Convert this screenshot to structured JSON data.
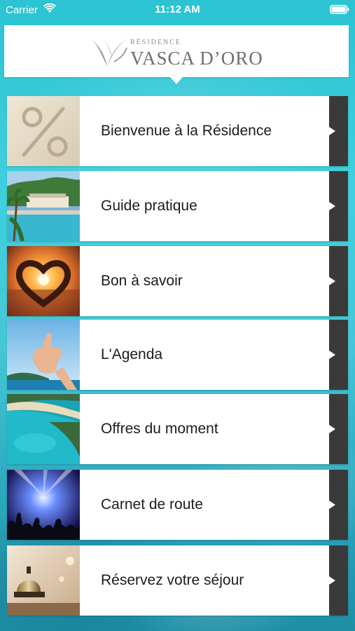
{
  "status_bar": {
    "carrier": "Carrier",
    "time": "11:12 AM"
  },
  "header": {
    "logo_small": "RÉSIDENCE",
    "logo_name": "VASCA D’ORO"
  },
  "menu": {
    "items": [
      {
        "label": "Bienvenue à la Résidence",
        "thumb": "percent-sign-in-sand"
      },
      {
        "label": "Guide pratique",
        "thumb": "resort-pool-palm-trees"
      },
      {
        "label": "Bon à savoir",
        "thumb": "heart-hands-sunset"
      },
      {
        "label": "L'Agenda",
        "thumb": "thumbs-up-sky"
      },
      {
        "label": "Offres du moment",
        "thumb": "turquoise-bay-aerial"
      },
      {
        "label": "Carnet de route",
        "thumb": "concert-stage-lights"
      },
      {
        "label": "Réservez votre séjour",
        "thumb": "reception-bell"
      }
    ]
  },
  "colors": {
    "arrow_strip": "#3a3a3a",
    "background_teal": "#3fd0de",
    "label_text": "#1c1c1c"
  }
}
